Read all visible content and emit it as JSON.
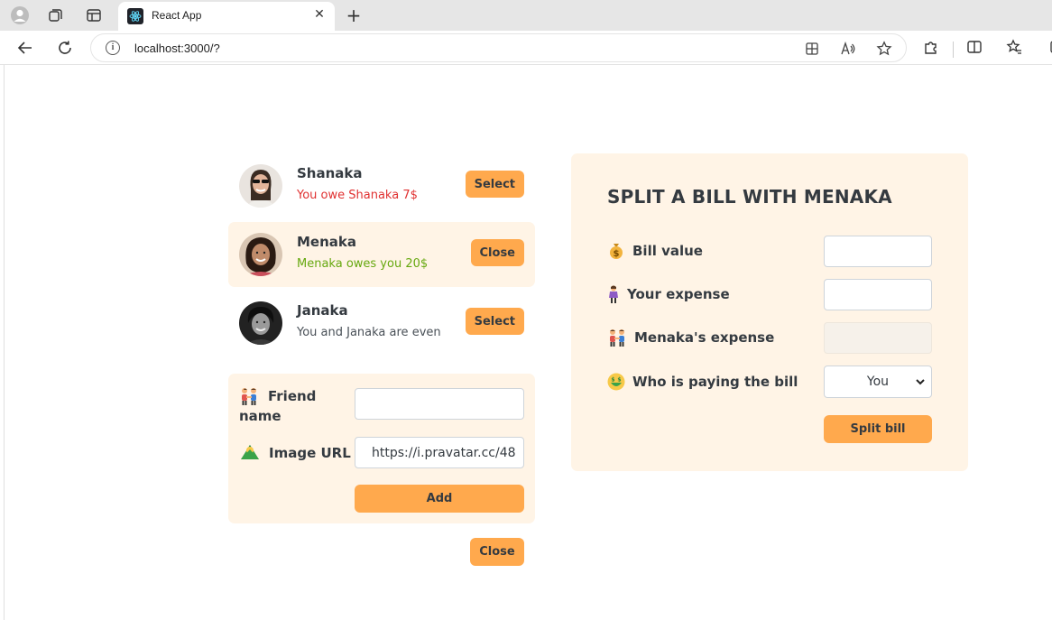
{
  "browser": {
    "tab_title": "React App",
    "new_tab": "+",
    "tab_close": "✕",
    "url": "localhost:3000/?"
  },
  "friends": [
    {
      "name": "Shanaka",
      "status": "You owe Shanaka 7$",
      "status_type": "owe",
      "button": "Select"
    },
    {
      "name": "Menaka",
      "status": "Menaka owes you 20$",
      "status_type": "owed",
      "button": "Close"
    },
    {
      "name": "Janaka",
      "status": "You and Janaka are even",
      "status_type": "even",
      "button": "Select"
    }
  ],
  "add_form": {
    "friend_label": "Friend name",
    "friend_value": "",
    "image_label": "Image URL",
    "image_value": "https://i.pravatar.cc/48",
    "add_button": "Add"
  },
  "close_button": "Close",
  "split": {
    "title": "SPLIT A BILL WITH MENAKA",
    "bill_label": "Bill value",
    "bill_value": "",
    "your_label": "Your expense",
    "your_value": "",
    "friend_label": "Menaka's expense",
    "friend_value": "",
    "payer_label": "Who is paying the bill",
    "payer_value": "You",
    "split_button": "Split bill"
  },
  "colors": {
    "accent": "#ffa94d",
    "panel": "#fff4e6",
    "red": "#e03131",
    "green": "#66a80f"
  }
}
